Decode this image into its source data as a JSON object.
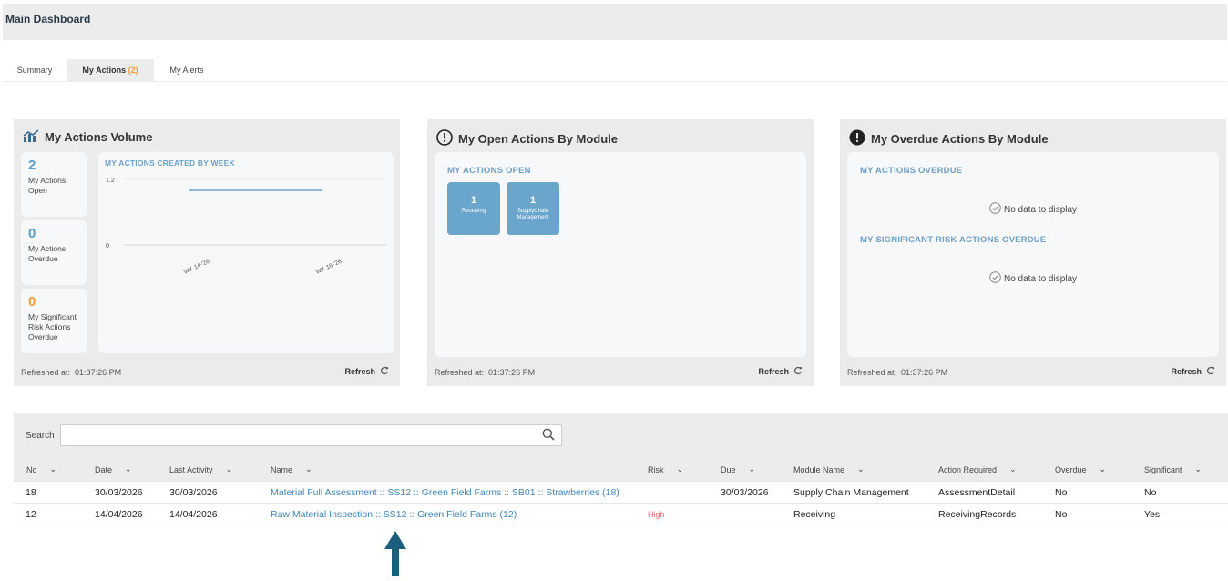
{
  "header": {
    "title": "Main Dashboard"
  },
  "tabs": [
    {
      "label": "Summary"
    },
    {
      "label": "My Actions",
      "count": "(2)"
    },
    {
      "label": "My Alerts"
    }
  ],
  "volume_panel": {
    "title": "My Actions Volume",
    "stats": [
      {
        "value": "2",
        "label": "My Actions Open"
      },
      {
        "value": "0",
        "label": "My Actions Overdue"
      },
      {
        "value": "0",
        "label": "My Significant Risk Actions Overdue"
      }
    ],
    "refreshed_label": "Refreshed at:",
    "refreshed_time": "01:37:26 PM",
    "refresh_label": "Refresh"
  },
  "chart_data": {
    "type": "line",
    "title": "MY ACTIONS CREATED BY WEEK",
    "categories": [
      "WK 14-'26",
      "WK 16-'26"
    ],
    "series": [
      {
        "values": [
          1,
          1
        ]
      }
    ],
    "ylim": [
      0,
      1.2
    ],
    "yticks": [
      "1.2",
      "0"
    ],
    "grid": true
  },
  "open_panel": {
    "title": "My Open Actions By Module",
    "subhead": "MY ACTIONS OPEN",
    "modules": [
      {
        "count": "1",
        "label": "Receiving"
      },
      {
        "count": "1",
        "label": "SupplyChain Management"
      }
    ],
    "refreshed_label": "Refreshed at:",
    "refreshed_time": "01:37:26 PM",
    "refresh_label": "Refresh"
  },
  "overdue_panel": {
    "title": "My Overdue Actions By Module",
    "subhead1": "MY ACTIONS OVERDUE",
    "nodata1": "No data to display",
    "subhead2": "MY SIGNIFICANT RISK ACTIONS OVERDUE",
    "nodata2": "No data to display",
    "refreshed_label": "Refreshed at:",
    "refreshed_time": "01:37:26 PM",
    "refresh_label": "Refresh"
  },
  "search": {
    "label": "Search",
    "value": "",
    "placeholder": ""
  },
  "table": {
    "columns": [
      "No",
      "Date",
      "Last Activity",
      "Name",
      "Risk",
      "Due",
      "Module Name",
      "Action Required",
      "Overdue",
      "Significant"
    ],
    "rows": [
      {
        "no": "18",
        "date": "30/03/2026",
        "last": "30/03/2026",
        "name": "Material Full Assessment :: SS12 :: Green Field Farms :: SB01 :: Strawberries (18)",
        "risk": "",
        "due": "30/03/2026",
        "module": "Supply Chain Management",
        "action": "AssessmentDetail",
        "overdue": "No",
        "significant": "No"
      },
      {
        "no": "12",
        "date": "14/04/2026",
        "last": "14/04/2026",
        "name": "Raw Material Inspection :: SS12 :: Green Field Farms (12)",
        "risk": "High",
        "due": "",
        "module": "Receiving",
        "action": "ReceivingRecords",
        "overdue": "No",
        "significant": "Yes"
      }
    ]
  },
  "colors": {
    "accent": "#5b9bc7",
    "warning": "#f29c38",
    "risk_high": "#f26a6a",
    "arrow": "#1c5e7e"
  }
}
